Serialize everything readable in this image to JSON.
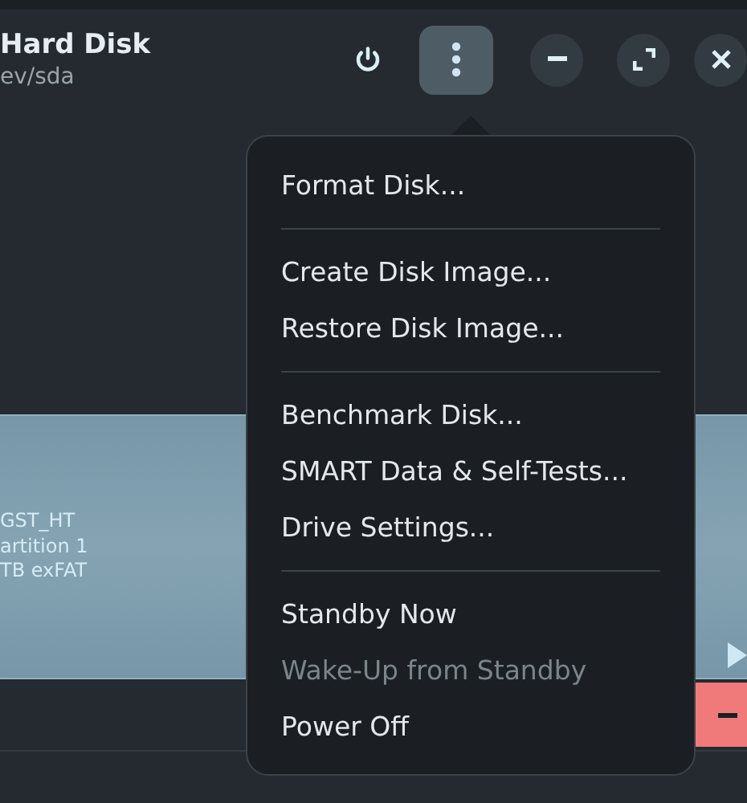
{
  "header": {
    "title": "Hard Disk",
    "subtitle": "ev/sda"
  },
  "partition": {
    "lines": [
      "GST_HT",
      "artition 1",
      "TB exFAT"
    ]
  },
  "menu": {
    "sections": [
      {
        "items": [
          {
            "label": "Format Disk...",
            "disabled": false
          }
        ]
      },
      {
        "items": [
          {
            "label": "Create Disk Image...",
            "disabled": false
          },
          {
            "label": "Restore Disk Image...",
            "disabled": false
          }
        ]
      },
      {
        "items": [
          {
            "label": "Benchmark Disk...",
            "disabled": false
          },
          {
            "label": "SMART Data & Self-Tests...",
            "disabled": false
          },
          {
            "label": "Drive Settings...",
            "disabled": false
          }
        ]
      },
      {
        "items": [
          {
            "label": "Standby Now",
            "disabled": false
          },
          {
            "label": "Wake-Up from Standby",
            "disabled": true
          },
          {
            "label": "Power Off",
            "disabled": false
          }
        ]
      }
    ]
  }
}
